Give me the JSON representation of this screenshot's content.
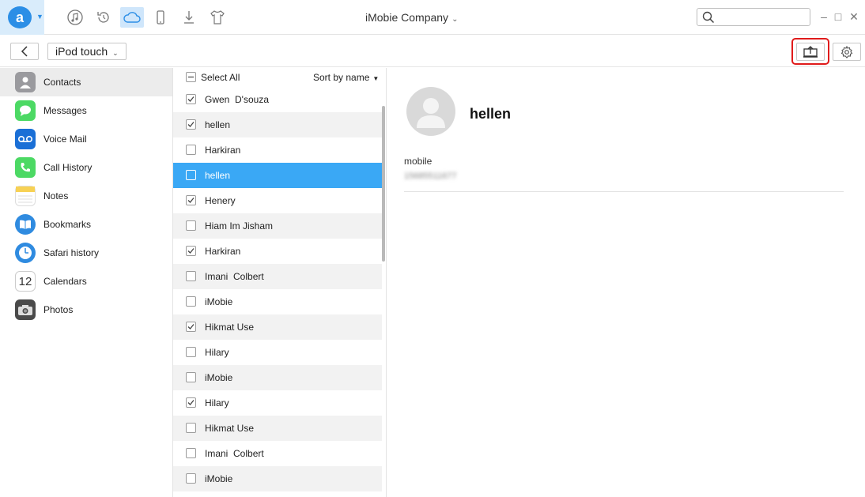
{
  "app": {
    "logo_letter": "a",
    "title": "iMobie Company",
    "title_caret": "⌄",
    "top_icons": [
      "music-icon",
      "restore-icon",
      "cloud-icon",
      "phone-icon",
      "download-icon",
      "tshirt-icon"
    ],
    "active_icon": "cloud-icon",
    "window_controls": {
      "minimize": "–",
      "maximize": "□",
      "close": "✕"
    }
  },
  "toolbar": {
    "device": "iPod touch",
    "device_caret": "⌄"
  },
  "sidebar": {
    "items": [
      {
        "label": "Contacts",
        "icon": "contacts-icon",
        "color": "#8e8e93"
      },
      {
        "label": "Messages",
        "icon": "messages-icon",
        "color": "#4cd964"
      },
      {
        "label": "Voice Mail",
        "icon": "voicemail-icon",
        "color": "#1a6fd6"
      },
      {
        "label": "Call History",
        "icon": "call-history-icon",
        "color": "#4cd964"
      },
      {
        "label": "Notes",
        "icon": "notes-icon",
        "color": "#f7d154"
      },
      {
        "label": "Bookmarks",
        "icon": "bookmarks-icon",
        "color": "#2f8be0"
      },
      {
        "label": "Safari history",
        "icon": "safari-icon",
        "color": "#2f8be0"
      },
      {
        "label": "Calendars",
        "icon": "calendar-icon",
        "color": "#ffffff",
        "text": "12"
      },
      {
        "label": "Photos",
        "icon": "camera-icon",
        "color": "#555555"
      }
    ],
    "active_index": 0
  },
  "list": {
    "select_all": "Select All",
    "sort_by": "Sort by name",
    "rows": [
      {
        "name": "Gwen  D'souza",
        "checked": true
      },
      {
        "name": "hellen",
        "checked": true
      },
      {
        "name": "Harkiran",
        "checked": false
      },
      {
        "name": "hellen",
        "checked": false,
        "selected": true
      },
      {
        "name": "Henery",
        "checked": true
      },
      {
        "name": "Hiam Im Jisham",
        "checked": false
      },
      {
        "name": "Harkiran",
        "checked": true
      },
      {
        "name": "Imani  Colbert",
        "checked": false
      },
      {
        "name": "iMobie",
        "checked": false
      },
      {
        "name": "Hikmat Use",
        "checked": true
      },
      {
        "name": "Hilary",
        "checked": false
      },
      {
        "name": "iMobie",
        "checked": false
      },
      {
        "name": "Hilary",
        "checked": true
      },
      {
        "name": "Hikmat Use",
        "checked": false
      },
      {
        "name": "Imani  Colbert",
        "checked": false
      },
      {
        "name": "iMobie",
        "checked": false
      }
    ]
  },
  "detail": {
    "name": "hellen",
    "field_label": "mobile",
    "field_value": "15685511677"
  },
  "colors": {
    "accent": "#3aa8f5",
    "highlight_border": "#e01b1b"
  }
}
